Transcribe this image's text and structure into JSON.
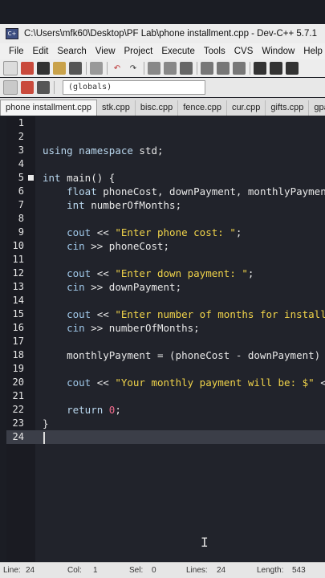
{
  "window": {
    "title": "C:\\Users\\mfk60\\Desktop\\PF Lab\\phone installment.cpp - Dev-C++ 5.7.1"
  },
  "menu": [
    "File",
    "Edit",
    "Search",
    "View",
    "Project",
    "Execute",
    "Tools",
    "CVS",
    "Window",
    "Help"
  ],
  "toolbar": {
    "scope_select": "(globals)"
  },
  "tabs": [
    "phone installment.cpp",
    "stk.cpp",
    "bisc.cpp",
    "fence.cpp",
    "cur.cpp",
    "gifts.cpp",
    "gpa."
  ],
  "editor": {
    "line_numbers": [
      "1",
      "2",
      "3",
      "4",
      "5",
      "6",
      "7",
      "8",
      "9",
      "10",
      "11",
      "12",
      "13",
      "14",
      "15",
      "16",
      "17",
      "18",
      "19",
      "20",
      "21",
      "22",
      "23",
      "24"
    ]
  },
  "status": {
    "line_label": "Line:",
    "line_value": "24",
    "col_label": "Col:",
    "col_value": "1",
    "sel_label": "Sel:",
    "sel_value": "0",
    "lines_label": "Lines:",
    "lines_value": "24",
    "length_label": "Length:",
    "length_value": "543"
  }
}
